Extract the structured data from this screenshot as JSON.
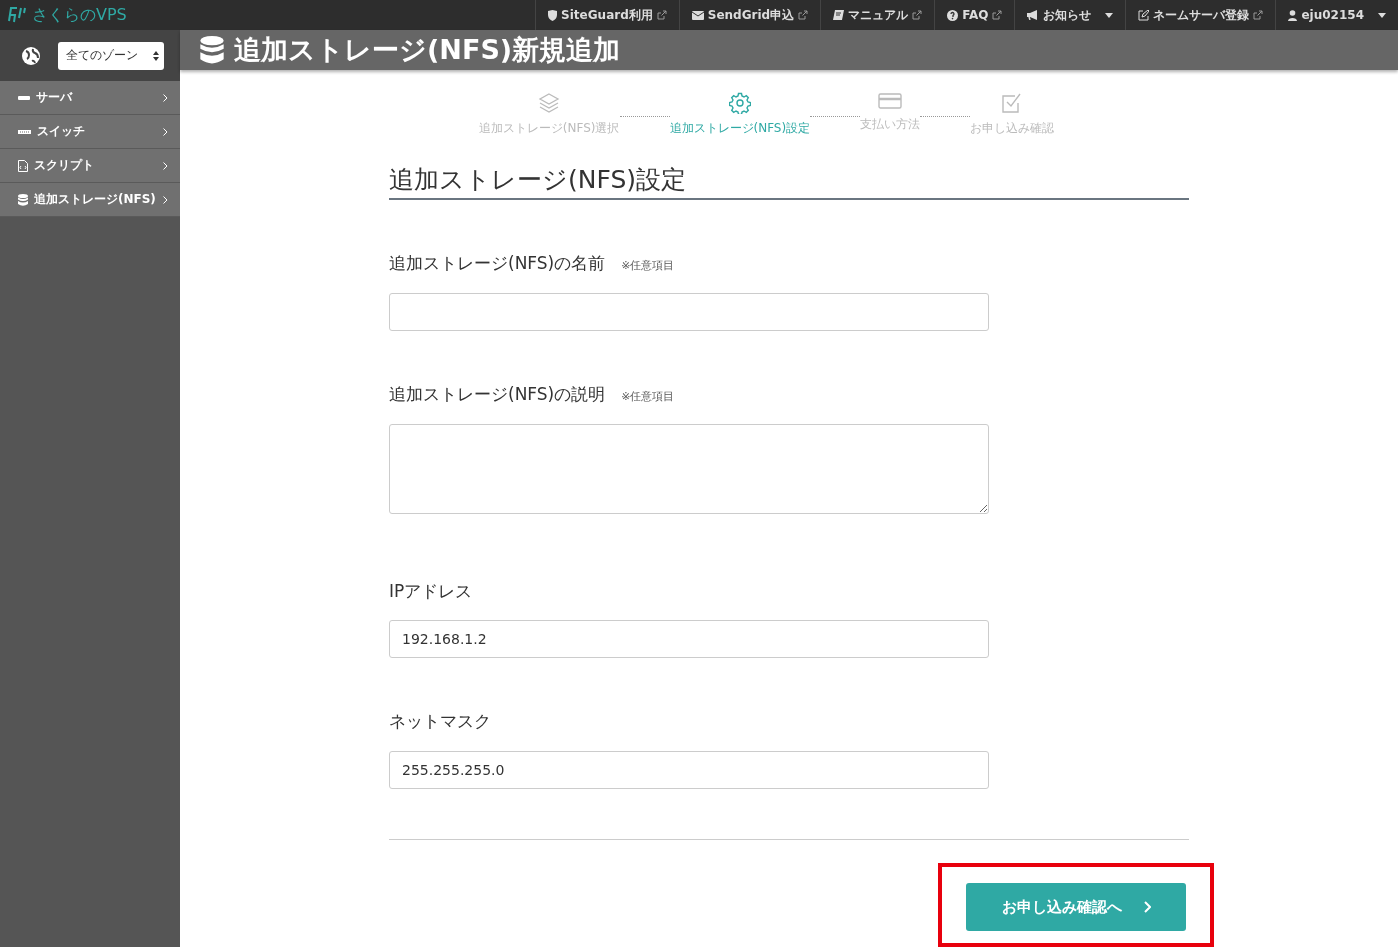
{
  "topbar": {
    "logo": "さくらのVPS",
    "nav": [
      {
        "label": "SiteGuard利用",
        "external": true,
        "dropdown": false
      },
      {
        "label": "SendGrid申込",
        "external": true,
        "dropdown": false
      },
      {
        "label": "マニュアル",
        "external": true,
        "dropdown": false
      },
      {
        "label": "FAQ",
        "external": true,
        "dropdown": false
      },
      {
        "label": "お知らせ",
        "external": false,
        "dropdown": true
      },
      {
        "label": "ネームサーバ登録",
        "external": true,
        "dropdown": false
      },
      {
        "label": "eju02154",
        "external": false,
        "dropdown": true
      }
    ]
  },
  "sidebar": {
    "zone_select": "全てのゾーン",
    "items": [
      {
        "label": "サーバ"
      },
      {
        "label": "スイッチ"
      },
      {
        "label": "スクリプト"
      },
      {
        "label": "追加ストレージ(NFS)"
      }
    ]
  },
  "page_title": "追加ストレージ(NFS)新規追加",
  "steps": [
    {
      "label": "追加ストレージ(NFS)選択",
      "selected": false
    },
    {
      "label": "追加ストレージ(NFS)設定",
      "selected": true
    },
    {
      "label": "支払い方法",
      "selected": false
    },
    {
      "label": "お申し込み確認",
      "selected": false
    }
  ],
  "section_title": "追加ストレージ(NFS)設定",
  "fields": [
    {
      "kind": "input",
      "label": "追加ストレージ(NFS)の名前",
      "note": "※任意項目"
    },
    {
      "kind": "textarea",
      "label": "追加ストレージ(NFS)の説明",
      "note": "※任意項目"
    },
    {
      "kind": "input",
      "label": "IPアドレス",
      "value": "192.168.1.2"
    },
    {
      "kind": "input",
      "label": "ネットマスク",
      "value": "255.255.255.0"
    }
  ],
  "submit": {
    "label": "お申し込み確認へ",
    "highlighted": true
  }
}
